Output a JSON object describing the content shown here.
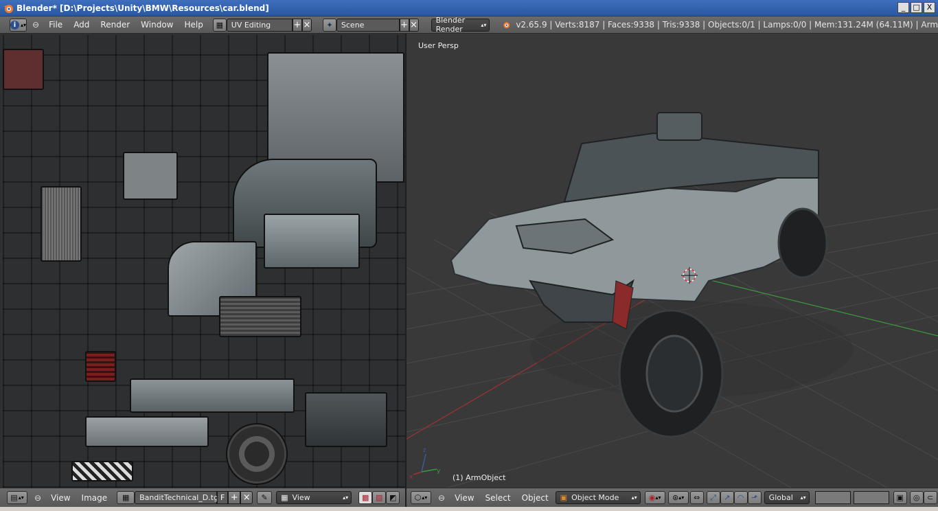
{
  "window": {
    "title": "Blender* [D:\\Projects\\Unity\\BMW\\Resources\\car.blend]",
    "buttons": [
      "_",
      "□",
      "X"
    ]
  },
  "infobar": {
    "menu": [
      "File",
      "Add",
      "Render",
      "Window",
      "Help"
    ],
    "screen_layout": "UV Editing",
    "scene": "Scene",
    "render_engine": "Blender Render",
    "stats": "v2.65.9 | Verts:8187 | Faces:9338 | Tris:9338 | Objects:0/1 | Lamps:0/0 | Mem:131.24M (64.11M) | Arm"
  },
  "viewport": {
    "view_label": "User Persp",
    "object_label": "(1) ArmObject"
  },
  "uv_header": {
    "menu": [
      "View",
      "Image"
    ],
    "image_name": "BanditTechnical_D.tga",
    "fake_user": "F",
    "view_select": "View"
  },
  "view3d_header": {
    "menu": [
      "View",
      "Select",
      "Object"
    ],
    "mode": "Object Mode",
    "orientation": "Global"
  },
  "colors": {
    "axis_x": "#a23232",
    "axis_y": "#3c9a3c",
    "axis_z": "#3c5aa0",
    "title_bar": "#2a57a0"
  }
}
